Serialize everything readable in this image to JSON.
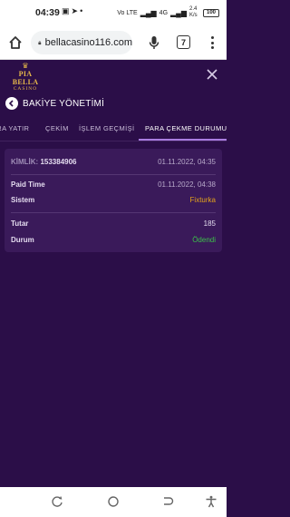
{
  "status_bar": {
    "time": "04:39",
    "left_icons": [
      "image-icon",
      "telegram-icon",
      "dot-icon"
    ],
    "network": "Vo LTE",
    "signal_label": "4G",
    "speed": "2.4 K/s",
    "battery": "100"
  },
  "browser": {
    "url": "bellacasino116.com",
    "tab_count": "7"
  },
  "brand": {
    "name": "PIA BELLA",
    "sub": "CASINO",
    "color": "#e6b84a"
  },
  "page": {
    "title": "BAKİYE YÖNETİMİ"
  },
  "tabs": [
    {
      "label": "PARA YATIR",
      "active": false
    },
    {
      "label": "ÇEKİM",
      "active": false
    },
    {
      "label": "İŞLEM GEÇMİŞİ",
      "active": false
    },
    {
      "label": "PARA ÇEKME DURUMU",
      "active": true
    }
  ],
  "transaction": {
    "id_label": "KİMLİK:",
    "id_value": "153384906",
    "created_date": "01.11.2022, 04:35",
    "paid_time_label": "Paid Time",
    "paid_time_value": "01.11.2022, 04:38",
    "system_label": "Sistem",
    "system_value": "Fixturka",
    "amount_label": "Tutar",
    "amount_value": "185",
    "status_label": "Durum",
    "status_value": "Ödendi"
  },
  "colors": {
    "background": "#2b0e48",
    "card": "#3a1a5a",
    "accent": "#a97ce0",
    "system": "#e3a21b",
    "success": "#3cc04a"
  }
}
